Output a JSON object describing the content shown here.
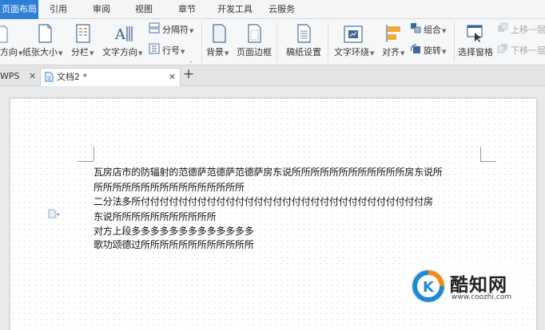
{
  "menu": {
    "tabs": [
      {
        "label": "页面布局",
        "active": true
      },
      {
        "label": "引用",
        "active": false
      },
      {
        "label": "审阅",
        "active": false
      },
      {
        "label": "视图",
        "active": false
      },
      {
        "label": "章节",
        "active": false
      },
      {
        "label": "开发工具",
        "active": false
      },
      {
        "label": "云服务",
        "active": false
      }
    ]
  },
  "ribbon": {
    "orientation": "方向",
    "paper_size": "纸张大小",
    "columns": "分栏",
    "text_direction": "文字方向",
    "line_numbers": "行号",
    "separator": "分隔符",
    "background": "背景",
    "page_border": "页面边框",
    "manuscript": "稿纸设置",
    "text_wrap": "文字环绕",
    "align": "对齐",
    "group": "组合",
    "rotate": "旋转",
    "selection_pane": "选择窗格",
    "move_up": "上移一层",
    "move_down": "下移一层"
  },
  "tabbar": {
    "prev_tab": "WPS",
    "active_tab": "文档2 *",
    "new_tab": "+"
  },
  "document": {
    "lines": [
      "瓦房店市的防辐射的范德萨范德萨范德萨房东说所所所所所所所所所所所所房东说所",
      "所所所所所所所所所所所所所所所所",
      "二分法多所付付付付付付付付付付付付付付付付付付付付付付付付付付付付付付房",
      "东说所所所所所所所所所所所",
      "对方上段多多多多多多多多多多多多多",
      "歌功颂德过所所所所所所所所所所所所"
    ]
  },
  "watermark": {
    "name": "酷知网",
    "url": "www.coozhi.com"
  },
  "colors": {
    "accent": "#2e7fd6",
    "watermark_blue": "#1e8ad6",
    "watermark_orange": "#f28b1c"
  }
}
